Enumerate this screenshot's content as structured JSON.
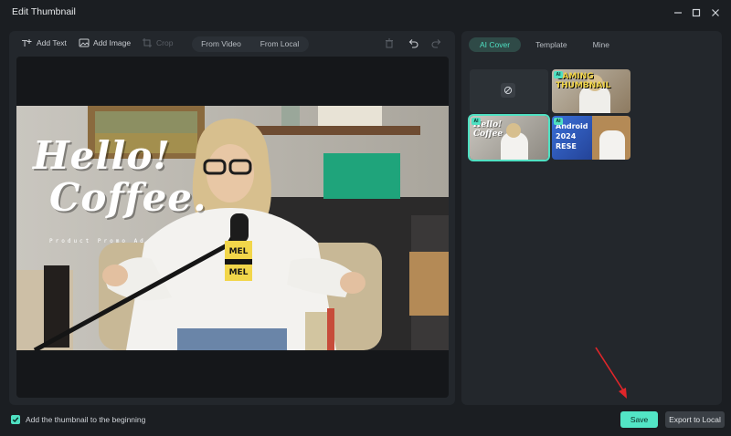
{
  "window": {
    "title": "Edit Thumbnail"
  },
  "toolbar": {
    "add_text": "Add Text",
    "add_image": "Add Image",
    "crop": "Crop",
    "from_video": "From Video",
    "from_local": "From Local"
  },
  "canvas": {
    "headline_line1": "Hello!",
    "headline_line2": "Coffee.",
    "mic_label": "MEL",
    "shirt_caption": "Product Promo Ad"
  },
  "side_tabs": [
    "AI Cover",
    "Template",
    "Mine"
  ],
  "covers": [
    {
      "name": "none"
    },
    {
      "name": "gaming",
      "text": "GAMING THUMBNAIL",
      "badge": "AI"
    },
    {
      "name": "hello-coffee",
      "text": "Hello! Coffee",
      "badge": "AI",
      "selected": true
    },
    {
      "name": "android",
      "text": "Android 2024 RESE",
      "badge": "AI"
    }
  ],
  "footer": {
    "checkbox_label": "Add the thumbnail to the beginning",
    "checkbox_checked": true,
    "save": "Save",
    "export": "Export to Local"
  },
  "colors": {
    "accent": "#4fe0c2",
    "annotation_arrow": "#e0262a"
  }
}
